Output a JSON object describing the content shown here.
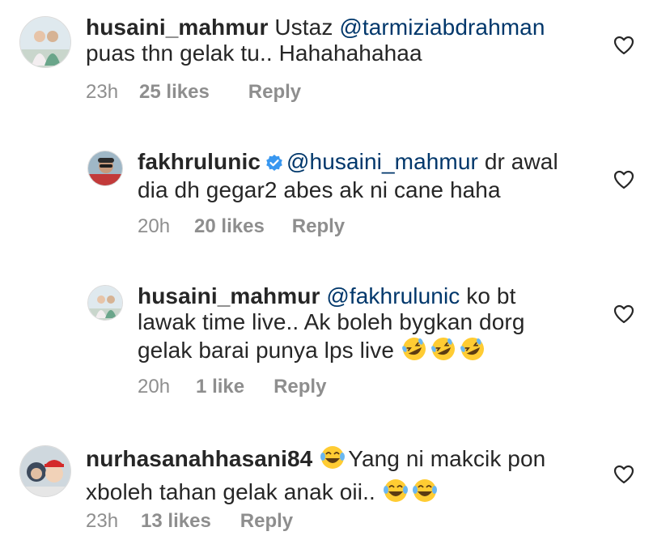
{
  "comments": [
    {
      "username": "husaini_mahmur",
      "text_pre": "Ustaz ",
      "mention": "@tarmiziabdrahman",
      "line2": "puas thn gelak tu.. Hahahahahaa",
      "time": "23h",
      "likes": "25 likes",
      "reply": "Reply"
    },
    {
      "username": "fakhrulunic",
      "verified": true,
      "mention": "@husaini_mahmur",
      "text_post": " dr awal",
      "line2": "dia dh gegar2 abes ak ni cane haha",
      "time": "20h",
      "likes": "20 likes",
      "reply": "Reply"
    },
    {
      "username": "husaini_mahmur",
      "mention": "@fakhrulunic",
      "text_post": " ko bt",
      "line2": "lawak time live.. Ak boleh bygkan dorg",
      "line3": "gelak barai punya lps live",
      "emoji": "rolling-on-floor-laughing x3",
      "time": "20h",
      "likes": "1 like",
      "reply": "Reply"
    },
    {
      "username": "nurhasanahhasani84",
      "text_post": "Yang ni makcik pon",
      "line2": "xboleh tahan gelak anak oii..",
      "emoji": "tears-of-joy",
      "time": "23h",
      "likes": "13 likes",
      "reply": "Reply"
    }
  ],
  "colors": {
    "text": "#262626",
    "mention": "#00376b",
    "meta": "#8e8e8e",
    "verified": "#3897f0",
    "emoji": "#ffcc33"
  }
}
